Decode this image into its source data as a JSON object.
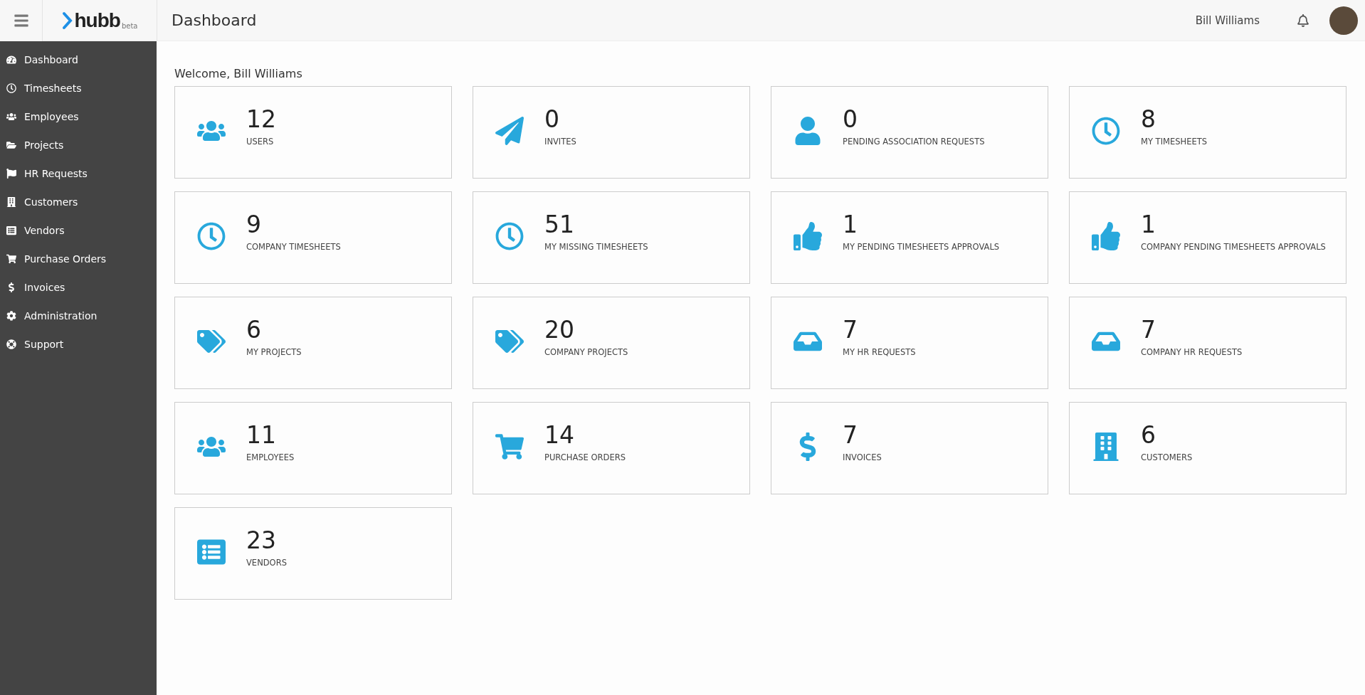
{
  "header": {
    "logo": {
      "name": "hubb",
      "tag": "beta"
    },
    "title": "Dashboard",
    "user_name": "Bill Williams"
  },
  "sidebar": {
    "items": [
      {
        "label": "Dashboard"
      },
      {
        "label": "Timesheets"
      },
      {
        "label": "Employees"
      },
      {
        "label": "Projects"
      },
      {
        "label": "HR Requests"
      },
      {
        "label": "Customers"
      },
      {
        "label": "Vendors"
      },
      {
        "label": "Purchase Orders"
      },
      {
        "label": "Invoices"
      },
      {
        "label": "Administration"
      },
      {
        "label": "Support"
      }
    ]
  },
  "welcome": "Welcome, Bill Williams",
  "cards": [
    {
      "value": "12",
      "label": "USERS"
    },
    {
      "value": "0",
      "label": "INVITES"
    },
    {
      "value": "0",
      "label": "PENDING ASSOCIATION REQUESTS"
    },
    {
      "value": "8",
      "label": "MY TIMESHEETS"
    },
    {
      "value": "9",
      "label": "COMPANY TIMESHEETS"
    },
    {
      "value": "51",
      "label": "MY MISSING TIMESHEETS"
    },
    {
      "value": "1",
      "label": "MY PENDING TIMESHEETS APPROVALS"
    },
    {
      "value": "1",
      "label": "COMPANY PENDING TIMESHEETS APPROVALS"
    },
    {
      "value": "6",
      "label": "MY PROJECTS"
    },
    {
      "value": "20",
      "label": "COMPANY PROJECTS"
    },
    {
      "value": "7",
      "label": "MY HR REQUESTS"
    },
    {
      "value": "7",
      "label": "COMPANY HR REQUESTS"
    },
    {
      "value": "11",
      "label": "EMPLOYEES"
    },
    {
      "value": "14",
      "label": "PURCHASE ORDERS"
    },
    {
      "value": "7",
      "label": "INVOICES"
    },
    {
      "value": "6",
      "label": "CUSTOMERS"
    },
    {
      "value": "23",
      "label": "VENDORS"
    }
  ]
}
